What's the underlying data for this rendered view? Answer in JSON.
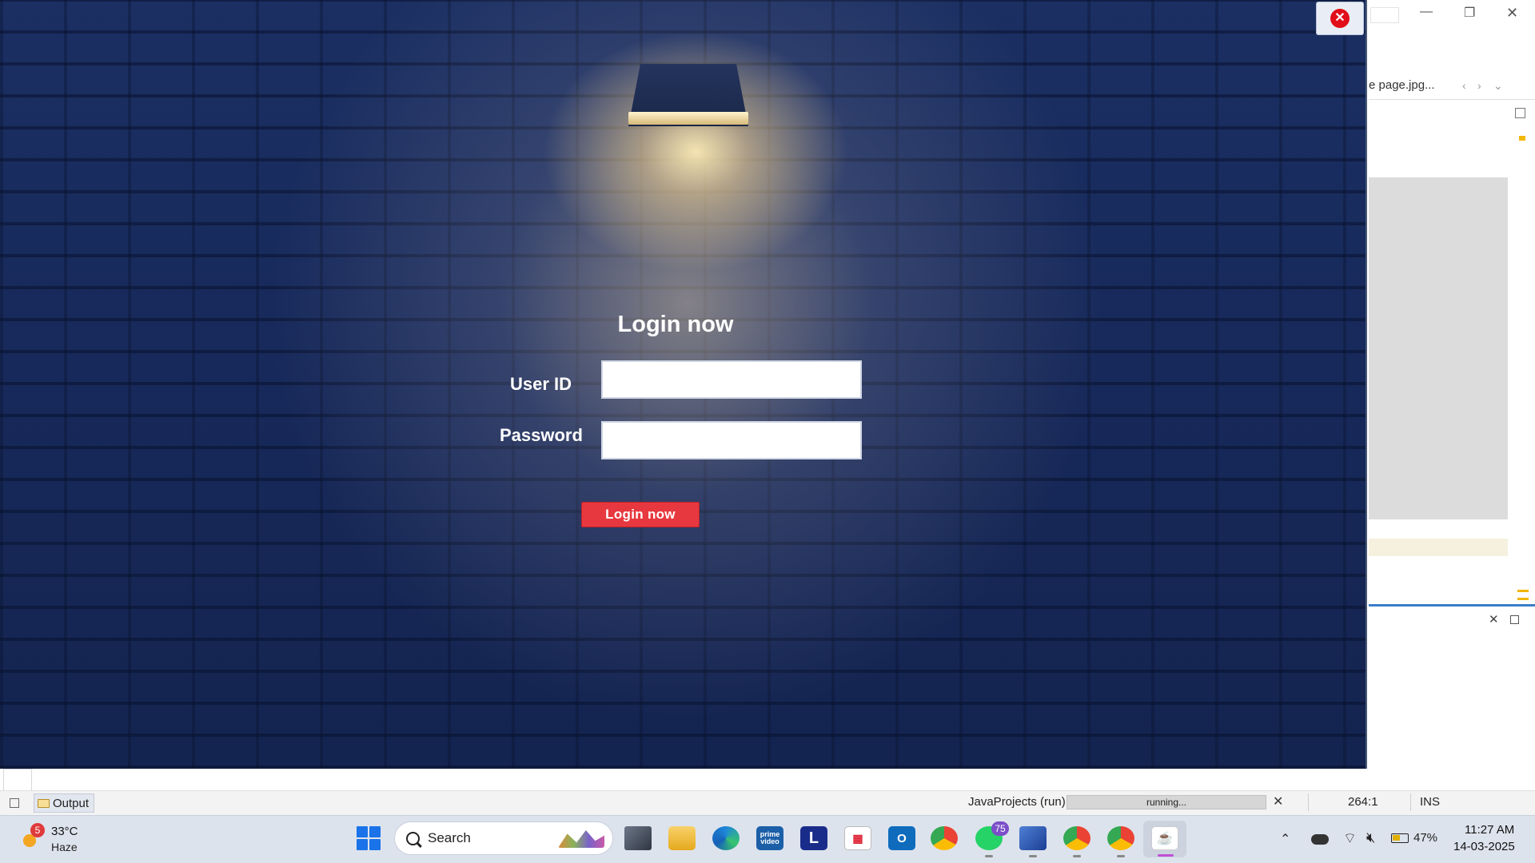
{
  "login_window": {
    "title": "Login now",
    "userid_label": "User ID",
    "userid_value": "",
    "password_label": "Password",
    "password_value": "",
    "login_button": "Login now",
    "close_icon": "close-x-icon"
  },
  "ide": {
    "editor_tab": "e page.jpg...",
    "output_tab": "Output",
    "run_label": "JavaProjects (run)",
    "run_status": "running...",
    "caret_position": "264:1",
    "insert_mode": "INS"
  },
  "taskbar": {
    "weather": {
      "badge": "5",
      "temp": "33°C",
      "condition": "Haze"
    },
    "search_label": "Search",
    "prime_label": "prime video",
    "lapp_label": "L",
    "whatsapp_badge": "75",
    "battery": "47%",
    "time": "11:27 AM",
    "date": "14-03-2025"
  },
  "colors": {
    "wall": "#1b2f63",
    "login_button": "#e8383f",
    "close_button": "#e10e1a"
  }
}
